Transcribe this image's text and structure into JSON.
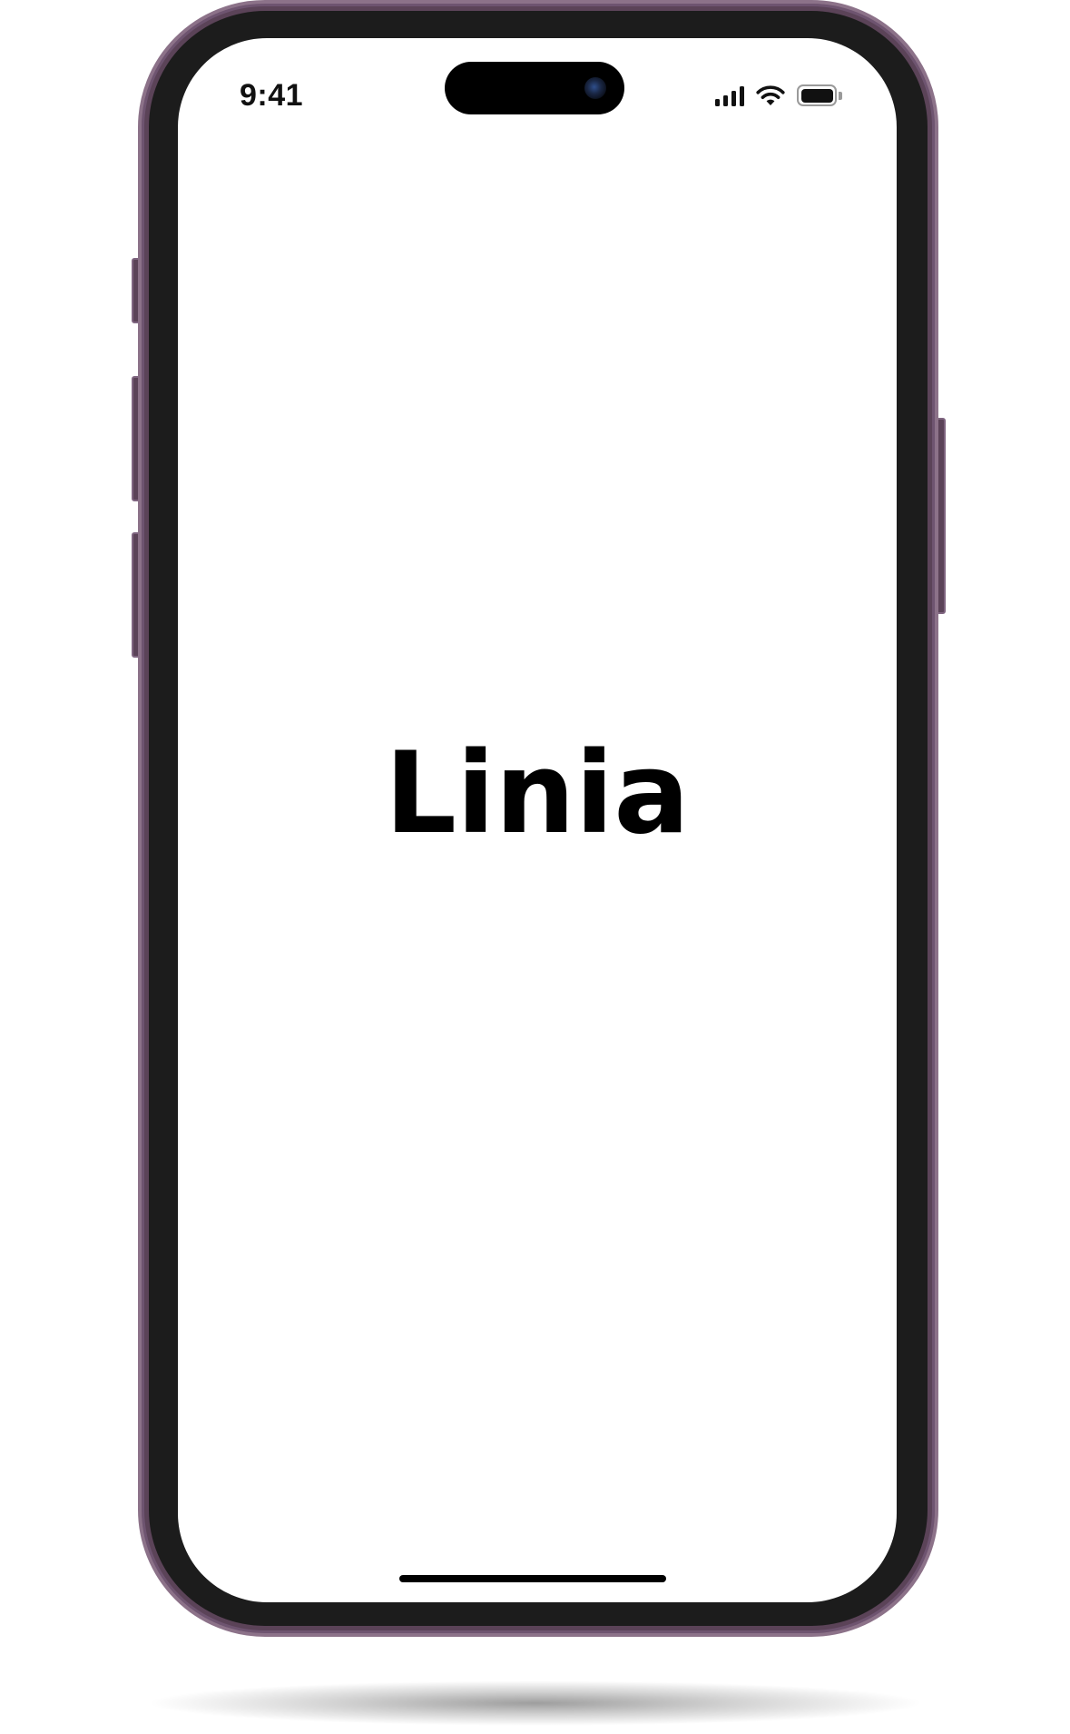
{
  "status_bar": {
    "time": "9:41",
    "icons": [
      "cellular-signal-icon",
      "wifi-icon",
      "battery-icon"
    ]
  },
  "splash": {
    "app_name": "Linia"
  },
  "device": {
    "frame_color": "#5b4358",
    "bezel_color": "#1c1c1c",
    "screen_color": "#ffffff"
  }
}
